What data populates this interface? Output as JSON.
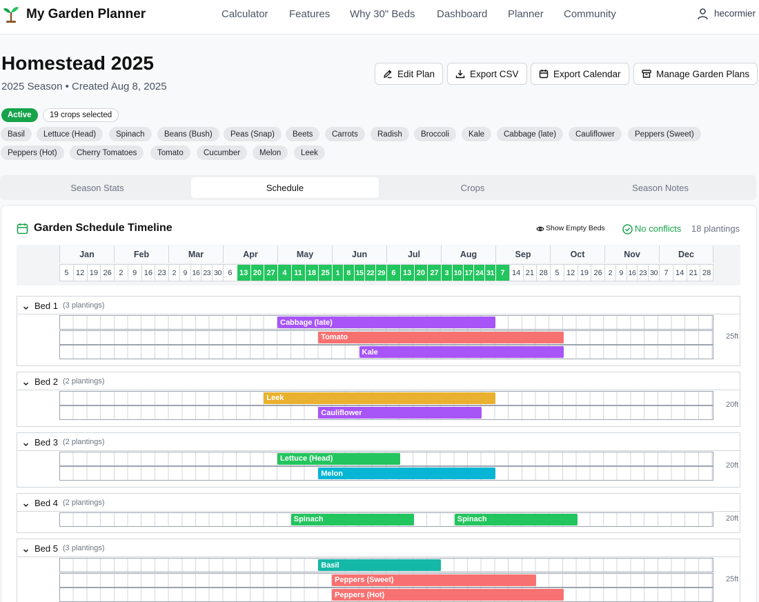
{
  "nav": {
    "brand": "My Garden Planner",
    "links": [
      "Calculator",
      "Features",
      "Why 30\" Beds",
      "Dashboard",
      "Planner",
      "Community"
    ],
    "username": "hecormier"
  },
  "plan": {
    "title": "Homestead 2025",
    "subtitle": "2025 Season • Created Aug 8, 2025",
    "status": "Active",
    "crops_selected": "19 crops selected",
    "actions": [
      "Edit Plan",
      "Export CSV",
      "Export Calendar",
      "Manage Garden Plans"
    ],
    "crops": [
      "Basil",
      "Lettuce (Head)",
      "Spinach",
      "Beans (Bush)",
      "Peas (Snap)",
      "Beets",
      "Carrots",
      "Radish",
      "Broccoli",
      "Kale",
      "Cabbage (late)",
      "Cauliflower",
      "Peppers (Sweet)",
      "Peppers (Hot)",
      "Cherry Tomatoes",
      "Tomato",
      "Cucumber",
      "Melon",
      "Leek"
    ]
  },
  "tabs": [
    "Season Stats",
    "Schedule",
    "Crops",
    "Season Notes"
  ],
  "active_tab": "Schedule",
  "timeline": {
    "title": "Garden Schedule Timeline",
    "show_empty": "Show Empty Beds",
    "no_conflicts": "No conflicts",
    "plantings": "18 plantings",
    "months": [
      "Jan",
      "Feb",
      "Mar",
      "Apr",
      "May",
      "Jun",
      "Jul",
      "Aug",
      "Sep",
      "Oct",
      "Nov",
      "Dec"
    ],
    "weeks": [
      [
        "5",
        "12",
        "19",
        "26"
      ],
      [
        "2",
        "9",
        "16",
        "23"
      ],
      [
        "2",
        "9",
        "16",
        "23",
        "30"
      ],
      [
        "6",
        "13",
        "20",
        "27"
      ],
      [
        "4",
        "11",
        "18",
        "25"
      ],
      [
        "1",
        "8",
        "15",
        "22",
        "29"
      ],
      [
        "6",
        "13",
        "20",
        "27"
      ],
      [
        "3",
        "10",
        "17",
        "24",
        "31"
      ],
      [
        "7",
        "14",
        "21",
        "28"
      ],
      [
        "5",
        "12",
        "19",
        "26"
      ],
      [
        "2",
        "9",
        "16",
        "23",
        "30"
      ],
      [
        "7",
        "14",
        "21",
        "28"
      ]
    ],
    "highlight_range": [
      14,
      35
    ]
  },
  "beds": [
    {
      "name": "Bed 1",
      "count": "(3 plantings)",
      "size": "25ft",
      "plantings": [
        {
          "crop": "Cabbage (late)",
          "color": "#a855f7",
          "start": 16,
          "end": 32
        },
        {
          "crop": "Tomato",
          "color": "#f87171",
          "start": 19,
          "end": 37
        },
        {
          "crop": "Kale",
          "color": "#a855f7",
          "start": 22,
          "end": 37
        }
      ]
    },
    {
      "name": "Bed 2",
      "count": "(2 plantings)",
      "size": "20ft",
      "plantings": [
        {
          "crop": "Leek",
          "color": "#eab02f",
          "start": 15,
          "end": 32
        },
        {
          "crop": "Cauliflower",
          "color": "#a855f7",
          "start": 19,
          "end": 31
        }
      ]
    },
    {
      "name": "Bed 3",
      "count": "(2 plantings)",
      "size": "20ft",
      "plantings": [
        {
          "crop": "Lettuce (Head)",
          "color": "#22c55e",
          "start": 16,
          "end": 25
        },
        {
          "crop": "Melon",
          "color": "#06b6d4",
          "start": 19,
          "end": 32
        }
      ]
    },
    {
      "name": "Bed 4",
      "count": "(2 plantings)",
      "size": "20ft",
      "lanes": 1,
      "plantings": [
        {
          "crop": "Spinach",
          "color": "#22c55e",
          "start": 17,
          "end": 26,
          "lane": 0
        },
        {
          "crop": "Spinach",
          "color": "#22c55e",
          "start": 29,
          "end": 38,
          "lane": 0
        }
      ]
    },
    {
      "name": "Bed 5",
      "count": "(3 plantings)",
      "size": "25ft",
      "plantings": [
        {
          "crop": "Basil",
          "color": "#14b8a6",
          "start": 19,
          "end": 28
        },
        {
          "crop": "Peppers (Sweet)",
          "color": "#f87171",
          "start": 20,
          "end": 35
        },
        {
          "crop": "Peppers (Hot)",
          "color": "#f87171",
          "start": 20,
          "end": 37
        }
      ]
    }
  ]
}
